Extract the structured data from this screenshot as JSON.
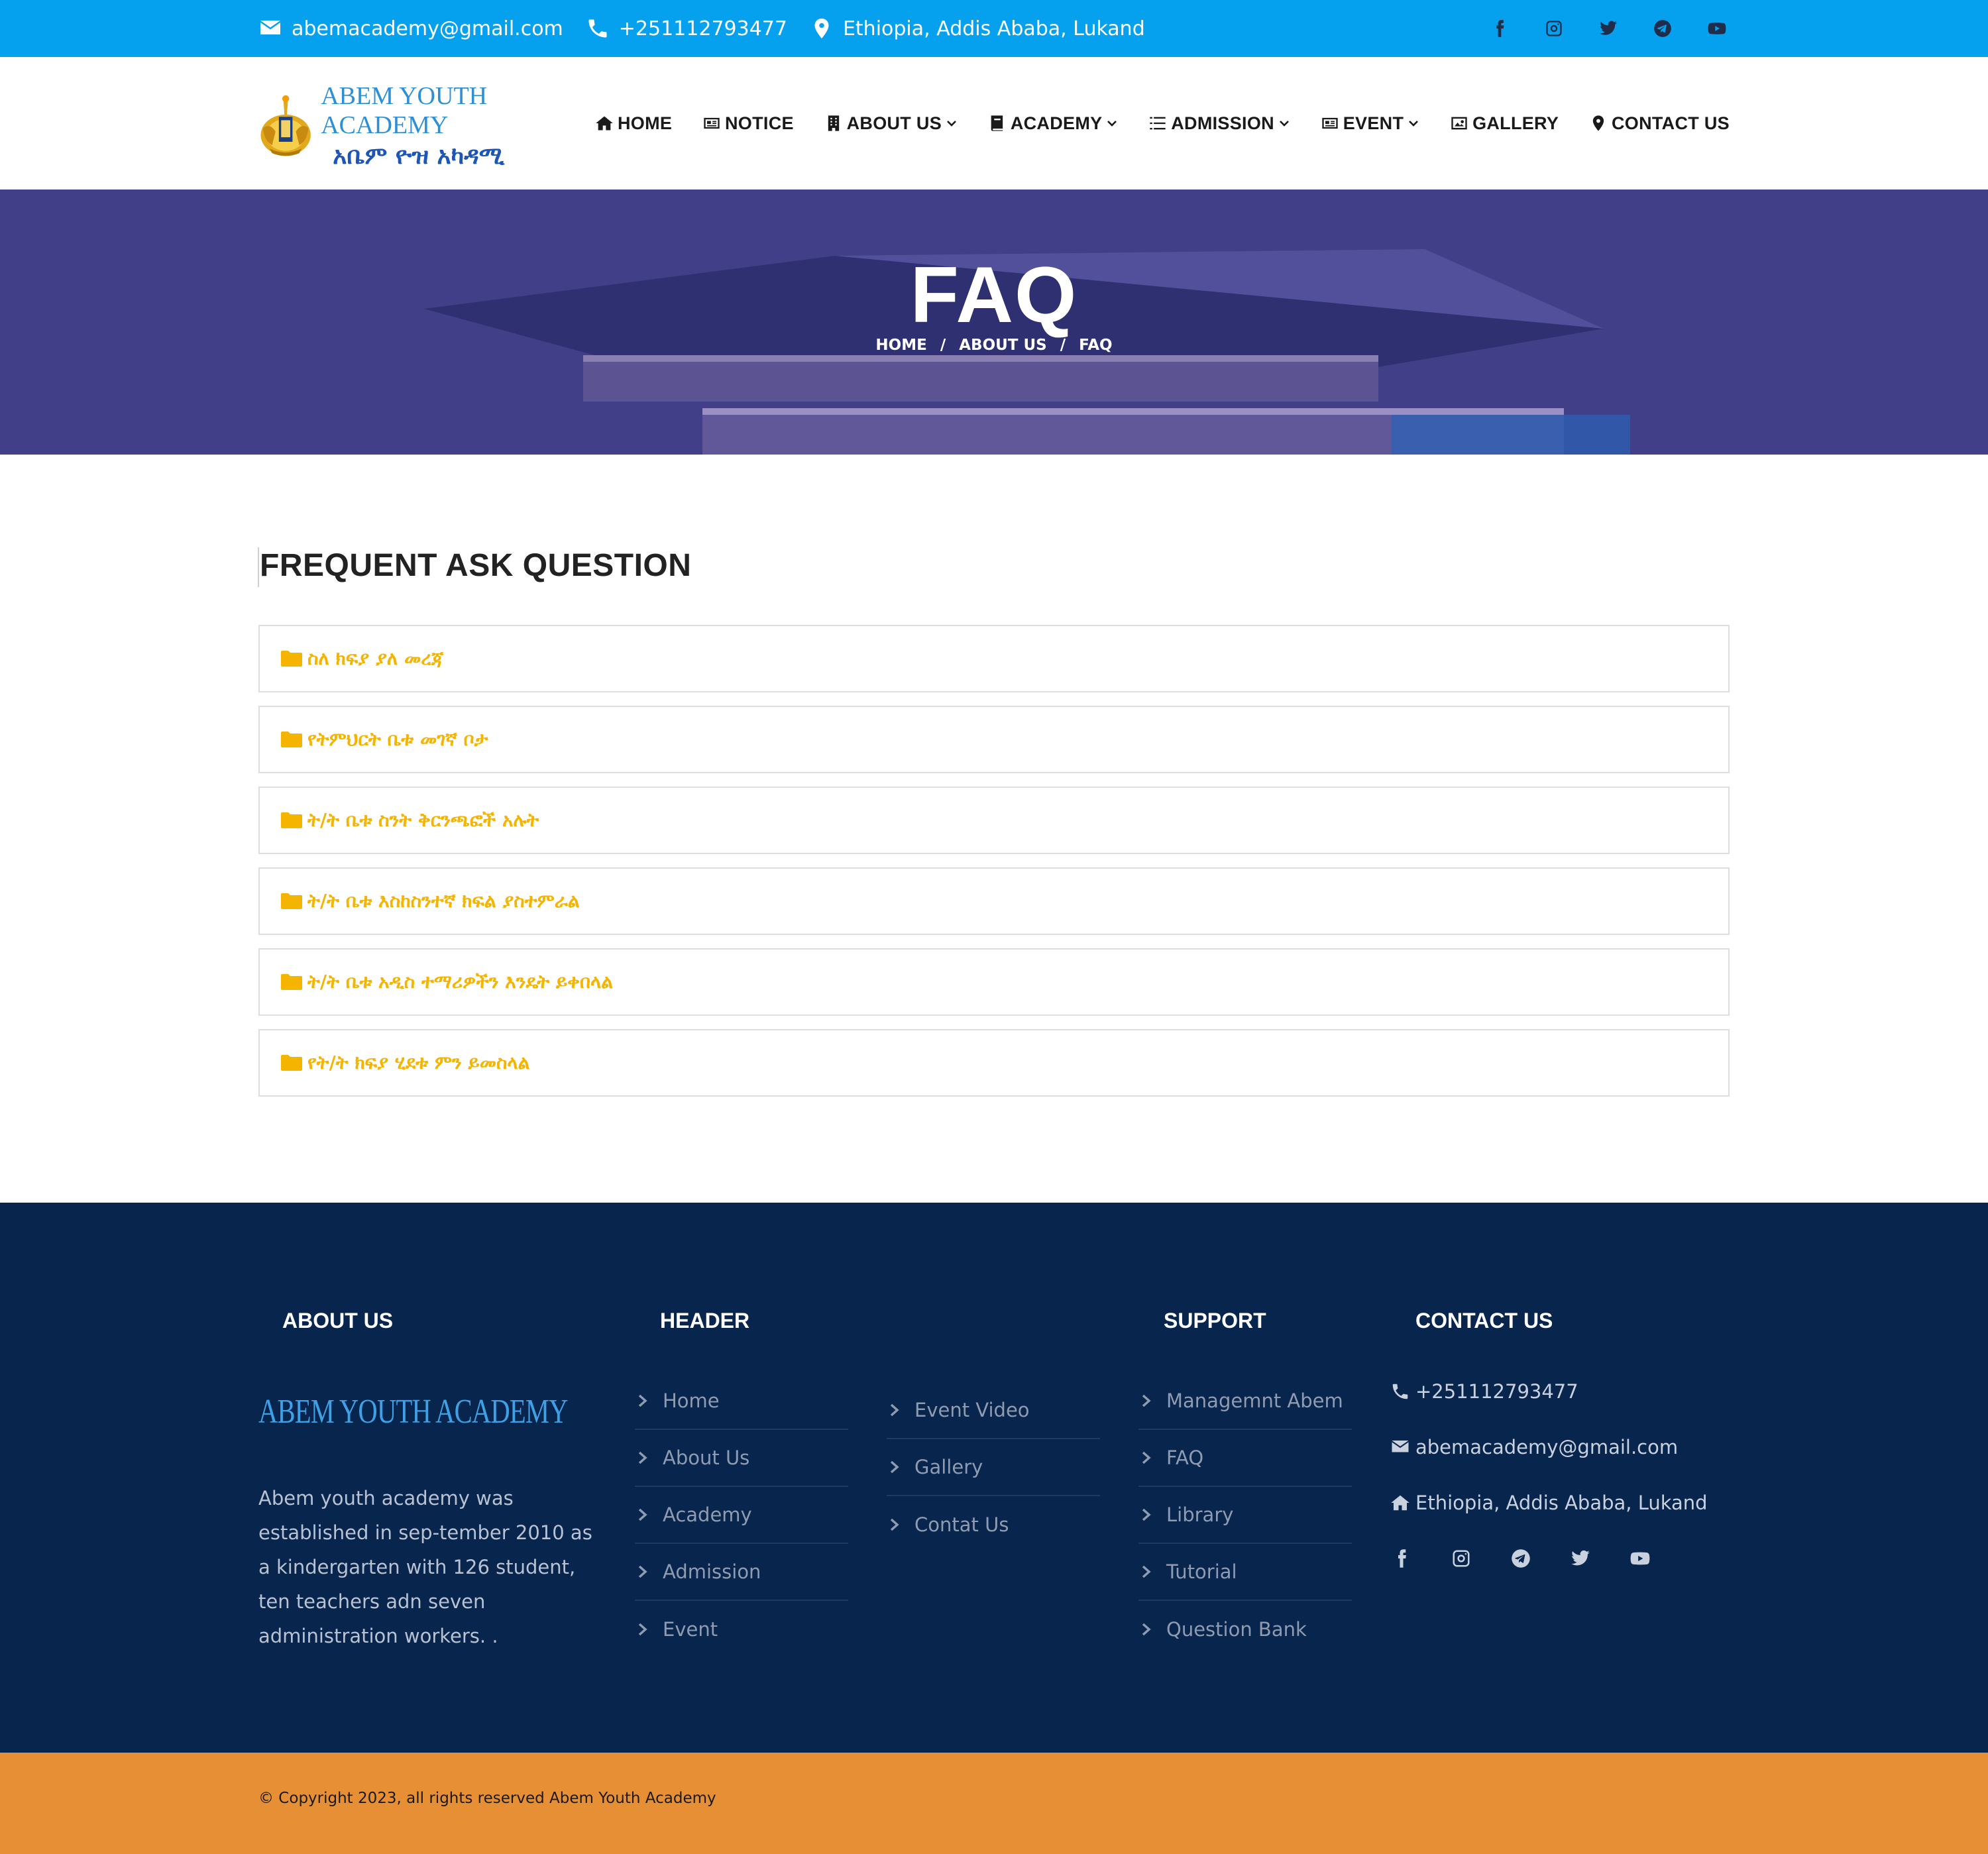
{
  "topbar": {
    "email": "abemacademy@gmail.com",
    "phone": "+251112793477",
    "address": "Ethiopia, Addis Ababa, Lukand",
    "socials": [
      "facebook-icon",
      "instagram-icon",
      "twitter-icon",
      "telegram-icon",
      "youtube-icon"
    ],
    "background": "#05a1ef"
  },
  "header": {
    "logo_en": "ABEM YOUTH ACADEMY",
    "logo_am": "አቤም ዮዝ አካዳሚ",
    "nav": [
      {
        "label": "HOME",
        "icon": "home-icon",
        "dropdown": false
      },
      {
        "label": "NOTICE",
        "icon": "newspaper-icon",
        "dropdown": false
      },
      {
        "label": "ABOUT US",
        "icon": "building-icon",
        "dropdown": true
      },
      {
        "label": "ACADEMY",
        "icon": "book-icon",
        "dropdown": true
      },
      {
        "label": "ADMISSION",
        "icon": "list-icon",
        "dropdown": true
      },
      {
        "label": "EVENT",
        "icon": "newspaper-icon",
        "dropdown": true
      },
      {
        "label": "GALLERY",
        "icon": "image-icon",
        "dropdown": false
      },
      {
        "label": "CONTACT US",
        "icon": "map-marker-icon",
        "dropdown": false
      }
    ]
  },
  "banner": {
    "title": "FAQ",
    "breadcrumb": [
      "HOME",
      "ABOUT US",
      "FAQ"
    ],
    "separator": "/"
  },
  "faq": {
    "heading": "FREQUENT ASK QUESTION",
    "accent": "#f4b400",
    "items": [
      "ስለ ክፍያ ያለ መረጃ",
      "የትምህርት ቤቱ መገኛ ቦታ",
      "ት/ት ቤቱ ስንት ቅርንጫፎች አሉት",
      "ት/ት ቤቱ እስከስንተኛ ክፍል ያስተምራል",
      "ት/ት ቤቱ አዲስ ተማሪዎችን እንዴት ይቀበላል",
      "የት/ት ክፍያ ሂደቱ ምን ይመስላል"
    ]
  },
  "footer": {
    "background": "#08264d",
    "about": {
      "title": "ABOUT US",
      "logo_text": "ABEM YOUTH ACADEMY",
      "text": "Abem youth academy was established in sep-tember 2010 as a kindergarten with 126 student, ten teachers adn seven administration workers. ."
    },
    "header_col": {
      "title": "HEADER",
      "links_a": [
        "Home",
        "About Us",
        "Academy",
        "Admission",
        "Event"
      ],
      "links_b": [
        "Event Video",
        "Gallery",
        "Contat Us"
      ]
    },
    "support": {
      "title": "SUPPORT",
      "links": [
        "Managemnt Abem",
        "FAQ",
        "Library",
        "Tutorial",
        "Question Bank"
      ]
    },
    "contact": {
      "title": "CONTACT US",
      "phone": "+251112793477",
      "email": "abemacademy@gmail.com",
      "address": "Ethiopia, Addis Ababa, Lukand",
      "socials": [
        "facebook-icon",
        "instagram-icon",
        "telegram-icon",
        "twitter-icon",
        "youtube-icon"
      ]
    }
  },
  "copyright": {
    "text": "© Copyright 2023, all rights reserved Abem Youth Academy",
    "background": "#e78f35"
  }
}
